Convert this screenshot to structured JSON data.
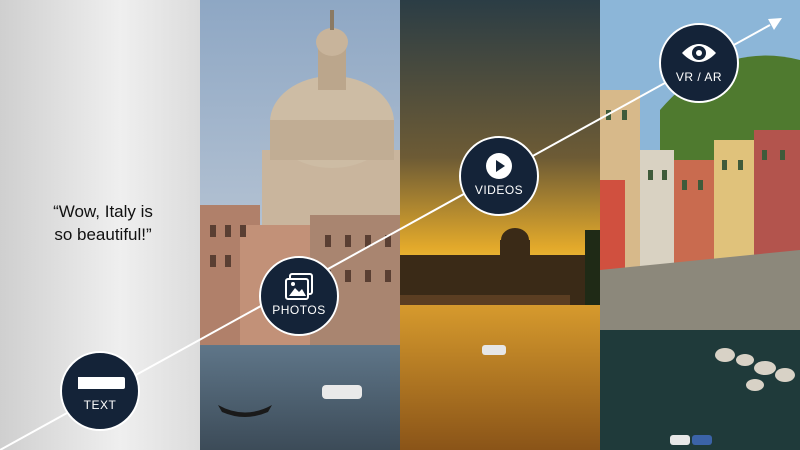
{
  "quote": {
    "line1": "“Wow, Italy is",
    "line2": "so beautiful!”"
  },
  "badges": {
    "text": {
      "label": "TEXT",
      "icon": "text-bar-icon"
    },
    "photos": {
      "label": "PHOTOS",
      "icon": "photos-icon"
    },
    "videos": {
      "label": "VIDEOS",
      "icon": "play-icon"
    },
    "vr": {
      "label": "VR / AR",
      "icon": "eye-icon"
    }
  },
  "panels": [
    "text-panel",
    "venice-photo",
    "rome-sunset-video",
    "cinque-terre-vr"
  ],
  "colors": {
    "badge": "#142338",
    "line": "#ffffff"
  }
}
